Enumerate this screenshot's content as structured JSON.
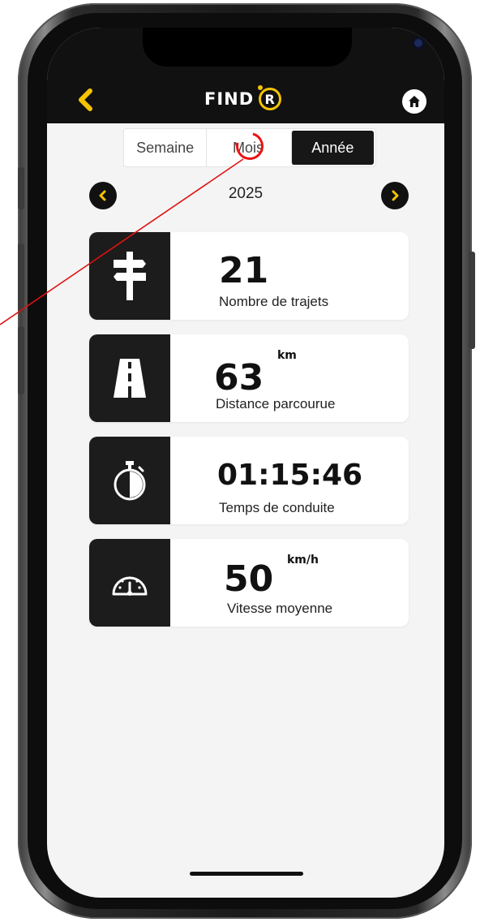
{
  "app": {
    "logo_text": "FIND",
    "logo_letter": "R"
  },
  "header": {
    "back_icon": "chevron-left-icon",
    "home_icon": "home-icon"
  },
  "tabs": [
    {
      "label": "Semaine",
      "active": false
    },
    {
      "label": "Mois",
      "active": false
    },
    {
      "label": "Année",
      "active": true
    }
  ],
  "period": {
    "year": "2025"
  },
  "stats": [
    {
      "icon": "signpost-icon",
      "value": "21",
      "unit": "",
      "label": "Nombre de trajets"
    },
    {
      "icon": "road-icon",
      "value": "63",
      "unit": "km",
      "label": "Distance parcourue"
    },
    {
      "icon": "stopwatch-icon",
      "value": "01:15:46",
      "unit": "",
      "label": "Temps de conduite"
    },
    {
      "icon": "speedometer-icon",
      "value": "50",
      "unit": "km/h",
      "label": "Vitesse moyenne"
    }
  ],
  "colors": {
    "accent": "#f5c400",
    "dark": "#111111",
    "background": "#f4f4f4",
    "annotation": "#e11111"
  }
}
